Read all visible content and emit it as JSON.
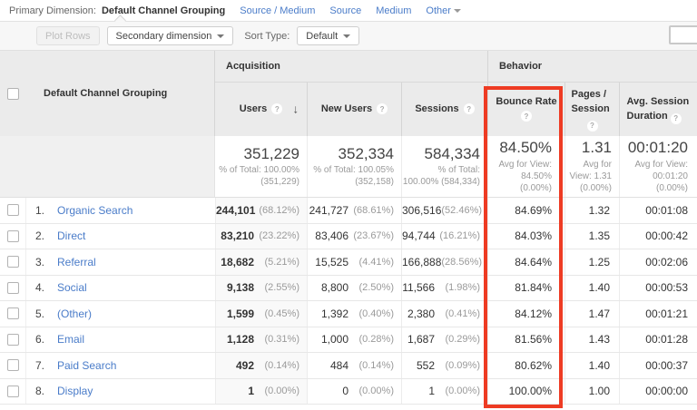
{
  "colors": {
    "highlight_red": "#ee3b23",
    "link_blue": "#4a7cc9"
  },
  "primary_dimension_bar": {
    "label": "Primary Dimension:",
    "selected": "Default Channel Grouping",
    "link_source_medium": "Source / Medium",
    "link_source": "Source",
    "link_medium": "Medium",
    "link_other": "Other"
  },
  "toolbar": {
    "plot_rows_label": "Plot Rows",
    "secondary_dimension_label": "Secondary dimension",
    "sort_type_label": "Sort Type:",
    "sort_type_value": "Default"
  },
  "table": {
    "dimension_column_header": "Default Channel Grouping",
    "group_acquisition": "Acquisition",
    "group_behavior": "Behavior",
    "col_users": "Users",
    "col_new_users": "New Users",
    "col_sessions": "Sessions",
    "col_bounce_rate": "Bounce Rate",
    "col_pages_session": "Pages / Session",
    "col_avg_session_duration": "Avg. Session Duration",
    "help_glyph": "?",
    "sort_arrow": "↓",
    "totals": {
      "users": "351,229",
      "users_sub": "% of Total: 100.00% (351,229)",
      "new_users": "352,334",
      "new_users_sub": "% of Total: 100.05% (352,158)",
      "sessions": "584,334",
      "sessions_sub": "% of Total: 100.00% (584,334)",
      "bounce": "84.50%",
      "bounce_sub": "Avg for View: 84.50% (0.00%)",
      "pages": "1.31",
      "pages_sub": "Avg for View: 1.31 (0.00%)",
      "duration": "00:01:20",
      "duration_sub": "Avg for View: 00:01:20 (0.00%)"
    },
    "rows": [
      {
        "num": "1.",
        "channel": "Organic Search",
        "users": "244,101",
        "users_pct": "(68.12%)",
        "new_users": "241,727",
        "new_users_pct": "(68.61%)",
        "sessions": "306,516",
        "sessions_pct": "(52.46%)",
        "bounce": "84.69%",
        "pages": "1.32",
        "duration": "00:01:08"
      },
      {
        "num": "2.",
        "channel": "Direct",
        "users": "83,210",
        "users_pct": "(23.22%)",
        "new_users": "83,406",
        "new_users_pct": "(23.67%)",
        "sessions": "94,744",
        "sessions_pct": "(16.21%)",
        "bounce": "84.03%",
        "pages": "1.35",
        "duration": "00:00:42"
      },
      {
        "num": "3.",
        "channel": "Referral",
        "users": "18,682",
        "users_pct": "(5.21%)",
        "new_users": "15,525",
        "new_users_pct": "(4.41%)",
        "sessions": "166,888",
        "sessions_pct": "(28.56%)",
        "bounce": "84.64%",
        "pages": "1.25",
        "duration": "00:02:06"
      },
      {
        "num": "4.",
        "channel": "Social",
        "users": "9,138",
        "users_pct": "(2.55%)",
        "new_users": "8,800",
        "new_users_pct": "(2.50%)",
        "sessions": "11,566",
        "sessions_pct": "(1.98%)",
        "bounce": "81.84%",
        "pages": "1.40",
        "duration": "00:00:53"
      },
      {
        "num": "5.",
        "channel": "(Other)",
        "users": "1,599",
        "users_pct": "(0.45%)",
        "new_users": "1,392",
        "new_users_pct": "(0.40%)",
        "sessions": "2,380",
        "sessions_pct": "(0.41%)",
        "bounce": "84.12%",
        "pages": "1.47",
        "duration": "00:01:21"
      },
      {
        "num": "6.",
        "channel": "Email",
        "users": "1,128",
        "users_pct": "(0.31%)",
        "new_users": "1,000",
        "new_users_pct": "(0.28%)",
        "sessions": "1,687",
        "sessions_pct": "(0.29%)",
        "bounce": "81.56%",
        "pages": "1.43",
        "duration": "00:01:28"
      },
      {
        "num": "7.",
        "channel": "Paid Search",
        "users": "492",
        "users_pct": "(0.14%)",
        "new_users": "484",
        "new_users_pct": "(0.14%)",
        "sessions": "552",
        "sessions_pct": "(0.09%)",
        "bounce": "80.62%",
        "pages": "1.40",
        "duration": "00:00:37"
      },
      {
        "num": "8.",
        "channel": "Display",
        "users": "1",
        "users_pct": "(0.00%)",
        "new_users": "0",
        "new_users_pct": "(0.00%)",
        "sessions": "1",
        "sessions_pct": "(0.00%)",
        "bounce": "100.00%",
        "pages": "1.00",
        "duration": "00:00:00"
      }
    ]
  }
}
